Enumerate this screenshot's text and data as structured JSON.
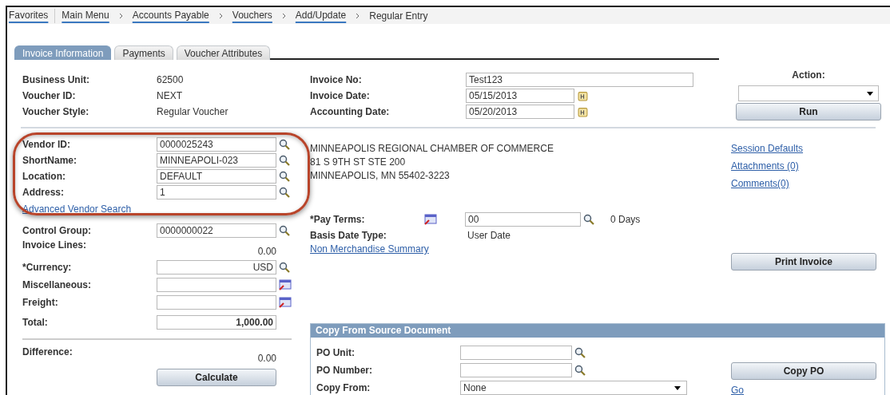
{
  "breadcrumb": [
    {
      "label": "Favorites",
      "menu": true
    },
    {
      "label": "Main Menu",
      "menu": true
    },
    {
      "label": "Accounts Payable",
      "menu": true
    },
    {
      "label": "Vouchers",
      "menu": true
    },
    {
      "label": "Add/Update",
      "menu": true
    },
    {
      "label": "Regular Entry",
      "menu": false
    }
  ],
  "tabs": [
    {
      "label": "Invoice Information",
      "selected": true
    },
    {
      "label": "Payments",
      "selected": false
    },
    {
      "label": "Voucher Attributes",
      "selected": false
    }
  ],
  "header_info": [
    {
      "label": "Business Unit:",
      "value": "62500"
    },
    {
      "label": "Voucher ID:",
      "value": "NEXT"
    },
    {
      "label": "Voucher Style:",
      "value": "Regular Voucher"
    }
  ],
  "invoice_fields": [
    {
      "label": "Invoice No:",
      "value": "Test123",
      "calendar": false
    },
    {
      "label": "Invoice Date:",
      "value": "05/15/2013",
      "calendar": true
    },
    {
      "label": "Accounting Date:",
      "value": "05/20/2013",
      "calendar": true
    }
  ],
  "action": {
    "label": "Action:",
    "button": "Run"
  },
  "vendor": {
    "highlighted": true,
    "fields": [
      {
        "label": "Vendor ID:",
        "value": "0000025243"
      },
      {
        "label": "ShortName:",
        "value": "MINNEAPOLI-023"
      },
      {
        "label": "Location:",
        "value": "DEFAULT"
      },
      {
        "label": "Address:",
        "value": "1"
      }
    ]
  },
  "vendor_address": [
    "MINNEAPOLIS REGIONAL CHAMBER OF COMMERCE",
    "81 S 9TH ST STE 200",
    "MINNEAPOLIS, MN  55402-3223"
  ],
  "links": [
    "Session Defaults",
    "Attachments (0)",
    "Comments(0)"
  ],
  "advanced_search": "Advanced Vendor Search",
  "amounts": [
    {
      "kind": "lookup",
      "label": "Control Group:",
      "value": "0000000022"
    },
    {
      "kind": "readout",
      "label": "Invoice Lines:",
      "value": "0.00"
    },
    {
      "kind": "right_lookup",
      "label": "*Currency:",
      "value": "USD"
    },
    {
      "kind": "detail",
      "label": "Miscellaneous:"
    },
    {
      "kind": "detail",
      "label": "Freight:"
    },
    {
      "kind": "total",
      "label": "Total:",
      "value": "1,000.00"
    },
    {
      "kind": "divider"
    },
    {
      "kind": "readout",
      "label": "Difference:",
      "value": "0.00"
    }
  ],
  "calculate": "Calculate",
  "pay_terms": {
    "label": "*Pay Terms:",
    "value": "00",
    "days": "0 Days"
  },
  "basis_date": {
    "label": "Basis Date Type:",
    "value": "User Date"
  },
  "summary_link": "Non Merchandise Summary",
  "print_button": "Print Invoice",
  "copy_source": {
    "title": "Copy From Source Document",
    "fields": [
      {
        "kind": "lookup",
        "label": "PO Unit:"
      },
      {
        "kind": "lookup",
        "label": "PO Number:"
      },
      {
        "kind": "select",
        "label": "Copy From:",
        "value": "None"
      }
    ]
  },
  "copy_button": "Copy PO",
  "go_link": "Go"
}
